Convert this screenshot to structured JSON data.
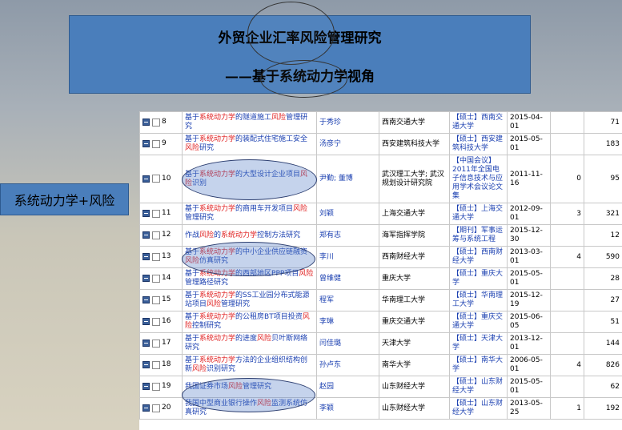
{
  "header": {
    "title_line1": "外贸企业汇率风险管理研究",
    "title_line2": "——基于系统动力学视角"
  },
  "side_label": "系统动力学+风险",
  "rows": [
    {
      "num": "8",
      "title": [
        [
          "基于",
          0
        ],
        [
          "系统动力学",
          1
        ],
        [
          "的隧道施工",
          0
        ],
        [
          "风险",
          1
        ],
        [
          "管理研究",
          0
        ]
      ],
      "author": "于秀珍",
      "org": "西南交通大学",
      "source": "【硕士】西南交通大学",
      "date": "2015-04-01",
      "cite": "",
      "download": "71"
    },
    {
      "num": "9",
      "title": [
        [
          "基于",
          0
        ],
        [
          "系统动力学",
          1
        ],
        [
          "的装配式住宅施工安全",
          0
        ],
        [
          "风险",
          1
        ],
        [
          "研究",
          0
        ]
      ],
      "author": "汤彦宁",
      "org": "西安建筑科技大学",
      "source": "【硕士】西安建筑科技大学",
      "date": "2015-05-01",
      "cite": "",
      "download": "183"
    },
    {
      "num": "10",
      "title": [
        [
          "基于",
          0
        ],
        [
          "系统动力学",
          1
        ],
        [
          "的大型设计企业项目",
          0
        ],
        [
          "风险",
          1
        ],
        [
          "识别",
          0
        ]
      ],
      "author": "尹勤; 董博",
      "org": "武汉理工大学; 武汉规划设计研究院",
      "source": "【中国会议】2011年全国电子信息技术与应用学术会议论文集",
      "date": "2011-11-16",
      "cite": "0",
      "download": "95"
    },
    {
      "num": "11",
      "title": [
        [
          "基于",
          0
        ],
        [
          "系统动力学",
          1
        ],
        [
          "的商用车开发项目",
          0
        ],
        [
          "风险",
          1
        ],
        [
          "管理研究",
          0
        ]
      ],
      "author": "刘颖",
      "org": "上海交通大学",
      "source": "【硕士】上海交通大学",
      "date": "2012-09-01",
      "cite": "3",
      "download": "321"
    },
    {
      "num": "12",
      "title": [
        [
          "作战",
          0
        ],
        [
          "风险",
          1
        ],
        [
          "的",
          0
        ],
        [
          "系统动力学",
          1
        ],
        [
          "控制方法研究",
          0
        ]
      ],
      "author": "郑有志",
      "org": "海军指挥学院",
      "source": "【期刊】军事运筹与系统工程",
      "date": "2015-12-30",
      "cite": "",
      "download": "12"
    },
    {
      "num": "13",
      "title": [
        [
          "基于",
          0
        ],
        [
          "系统动力学",
          1
        ],
        [
          "的中小企业供应链融资",
          0
        ],
        [
          "风险",
          1
        ],
        [
          "仿真研究",
          0
        ]
      ],
      "author": "李川",
      "org": "西南财经大学",
      "source": "【硕士】西南财经大学",
      "date": "2013-03-01",
      "cite": "4",
      "download": "590"
    },
    {
      "num": "14",
      "title": [
        [
          "基于",
          0
        ],
        [
          "系统动力学",
          1
        ],
        [
          "的西部地区PPP项目",
          0
        ],
        [
          "风险",
          1
        ],
        [
          "管理路径研究",
          0
        ]
      ],
      "author": "曾维健",
      "org": "重庆大学",
      "source": "【硕士】重庆大学",
      "date": "2015-05-01",
      "cite": "",
      "download": "28"
    },
    {
      "num": "15",
      "title": [
        [
          "基于",
          0
        ],
        [
          "系统动力学",
          1
        ],
        [
          "的SS工业园分布式能源站项目",
          0
        ],
        [
          "风险",
          1
        ],
        [
          "管理研究",
          0
        ]
      ],
      "author": "程军",
      "org": "华南理工大学",
      "source": "【硕士】华南理工大学",
      "date": "2015-12-19",
      "cite": "",
      "download": "27"
    },
    {
      "num": "16",
      "title": [
        [
          "基于",
          0
        ],
        [
          "系统动力学",
          1
        ],
        [
          "的公租房BT项目投资",
          0
        ],
        [
          "风险",
          1
        ],
        [
          "控制研究",
          0
        ]
      ],
      "author": "李琳",
      "org": "重庆交通大学",
      "source": "【硕士】重庆交通大学",
      "date": "2015-06-05",
      "cite": "",
      "download": "51"
    },
    {
      "num": "17",
      "title": [
        [
          "基于",
          0
        ],
        [
          "系统动力学",
          1
        ],
        [
          "的进度",
          0
        ],
        [
          "风险",
          1
        ],
        [
          "贝叶斯网络研究",
          0
        ]
      ],
      "author": "闫佳璐",
      "org": "天津大学",
      "source": "【硕士】天津大学",
      "date": "2013-12-01",
      "cite": "",
      "download": "144"
    },
    {
      "num": "18",
      "title": [
        [
          "基于",
          0
        ],
        [
          "系统动力学",
          1
        ],
        [
          "方法的企业组织结构创新",
          0
        ],
        [
          "风险",
          1
        ],
        [
          "识别研究",
          0
        ]
      ],
      "author": "孙卢东",
      "org": "南华大学",
      "source": "【硕士】南华大学",
      "date": "2006-05-01",
      "cite": "4",
      "download": "826"
    },
    {
      "num": "19",
      "title": [
        [
          "我国证券市场",
          0
        ],
        [
          "风险",
          1
        ],
        [
          "管理研究",
          0
        ]
      ],
      "author": "赵园",
      "org": "山东财经大学",
      "source": "【硕士】山东财经大学",
      "date": "2015-05-01",
      "cite": "",
      "download": "62"
    },
    {
      "num": "20",
      "title": [
        [
          "我国中型商业银行操作",
          0
        ],
        [
          "风险",
          1
        ],
        [
          "监测系统仿真研究",
          0
        ]
      ],
      "author": "李颖",
      "org": "山东财经大学",
      "source": "【硕士】山东财经大学",
      "date": "2013-05-25",
      "cite": "1",
      "download": "192"
    }
  ]
}
